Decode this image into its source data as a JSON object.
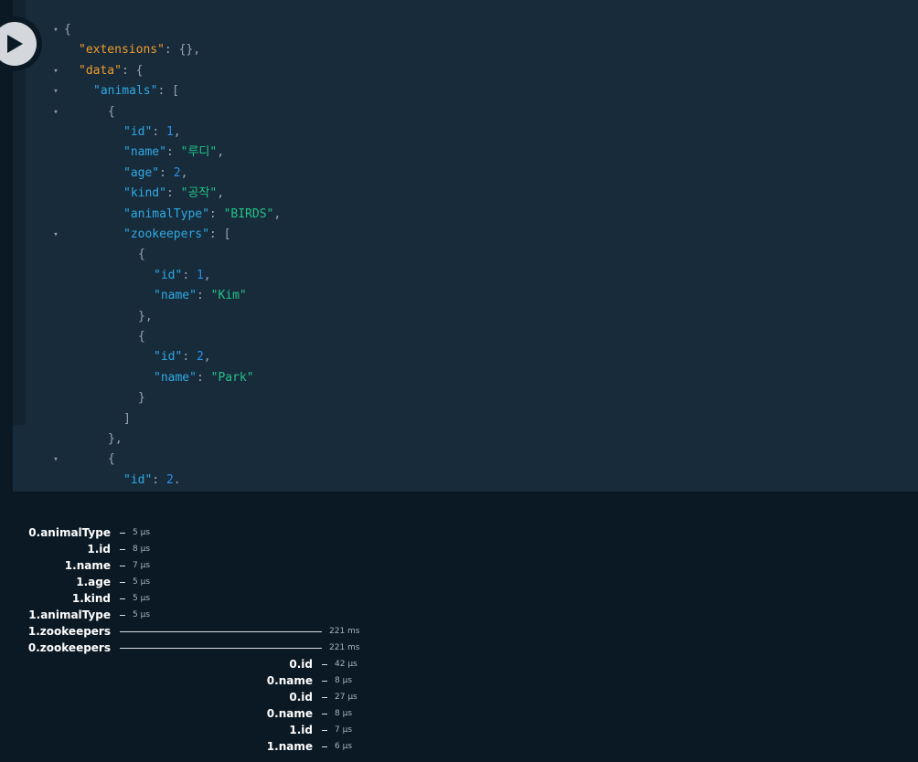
{
  "run_button": {
    "icon": "play-icon"
  },
  "result": {
    "lines": [
      {
        "segments": [
          [
            "p",
            "{"
          ]
        ]
      },
      {
        "segments": [
          [
            "k-top",
            "\"extensions\""
          ],
          [
            "p",
            ": {},"
          ]
        ]
      },
      {
        "segments": [
          [
            "k-top",
            "\"data\""
          ],
          [
            "p",
            ": {"
          ]
        ]
      },
      {
        "segments": [
          [
            "k",
            "\"animals\""
          ],
          [
            "p",
            ": ["
          ]
        ]
      },
      {
        "segments": [
          [
            "p",
            "{"
          ]
        ]
      },
      {
        "segments": [
          [
            "k",
            "\"id\""
          ],
          [
            "p",
            ": "
          ],
          [
            "n",
            "1"
          ],
          [
            "p",
            ","
          ]
        ]
      },
      {
        "segments": [
          [
            "k",
            "\"name\""
          ],
          [
            "p",
            ": "
          ],
          [
            "s",
            "\"루디\""
          ],
          [
            "p",
            ","
          ]
        ]
      },
      {
        "segments": [
          [
            "k",
            "\"age\""
          ],
          [
            "p",
            ": "
          ],
          [
            "n",
            "2"
          ],
          [
            "p",
            ","
          ]
        ]
      },
      {
        "segments": [
          [
            "k",
            "\"kind\""
          ],
          [
            "p",
            ": "
          ],
          [
            "s",
            "\"공작\""
          ],
          [
            "p",
            ","
          ]
        ]
      },
      {
        "segments": [
          [
            "k",
            "\"animalType\""
          ],
          [
            "p",
            ": "
          ],
          [
            "s",
            "\"BIRDS\""
          ],
          [
            "p",
            ","
          ]
        ]
      },
      {
        "segments": [
          [
            "k",
            "\"zookeepers\""
          ],
          [
            "p",
            ": ["
          ]
        ]
      },
      {
        "segments": [
          [
            "p",
            "{"
          ]
        ]
      },
      {
        "segments": [
          [
            "k",
            "\"id\""
          ],
          [
            "p",
            ": "
          ],
          [
            "n",
            "1"
          ],
          [
            "p",
            ","
          ]
        ]
      },
      {
        "segments": [
          [
            "k",
            "\"name\""
          ],
          [
            "p",
            ": "
          ],
          [
            "s",
            "\"Kim\""
          ]
        ]
      },
      {
        "segments": [
          [
            "p",
            "},"
          ]
        ]
      },
      {
        "segments": [
          [
            "p",
            "{"
          ]
        ]
      },
      {
        "segments": [
          [
            "k",
            "\"id\""
          ],
          [
            "p",
            ": "
          ],
          [
            "n",
            "2"
          ],
          [
            "p",
            ","
          ]
        ]
      },
      {
        "segments": [
          [
            "k",
            "\"name\""
          ],
          [
            "p",
            ": "
          ],
          [
            "s",
            "\"Park\""
          ]
        ]
      },
      {
        "segments": [
          [
            "p",
            "}"
          ]
        ]
      },
      {
        "segments": [
          [
            "p",
            "]"
          ]
        ]
      },
      {
        "segments": [
          [
            "p",
            "},"
          ]
        ]
      },
      {
        "segments": [
          [
            "p",
            "{"
          ]
        ]
      },
      {
        "segments": [
          [
            "k",
            "\"id\""
          ],
          [
            "p",
            ": "
          ],
          [
            "n",
            "2"
          ],
          [
            "p",
            "."
          ]
        ]
      }
    ],
    "fold_marker": "▾"
  },
  "tracing": {
    "rows": [
      {
        "label": "0.animalType",
        "duration": "5 µs"
      },
      {
        "label": "1.id",
        "duration": "8 µs"
      },
      {
        "label": "1.name",
        "duration": "7 µs"
      },
      {
        "label": "1.age",
        "duration": "5 µs"
      },
      {
        "label": "1.kind",
        "duration": "5 µs"
      },
      {
        "label": "1.animalType",
        "duration": "5 µs"
      },
      {
        "label": "1.zookeepers",
        "duration": "221 ms"
      },
      {
        "label": "0.zookeepers",
        "duration": "221 ms"
      },
      {
        "label": "0.id",
        "duration": "42 µs"
      },
      {
        "label": "0.name",
        "duration": "8 µs"
      },
      {
        "label": "0.id",
        "duration": "27 µs"
      },
      {
        "label": "0.name",
        "duration": "8 µs"
      },
      {
        "label": "1.id",
        "duration": "7 µs"
      },
      {
        "label": "1.name",
        "duration": "6 µs"
      }
    ]
  }
}
